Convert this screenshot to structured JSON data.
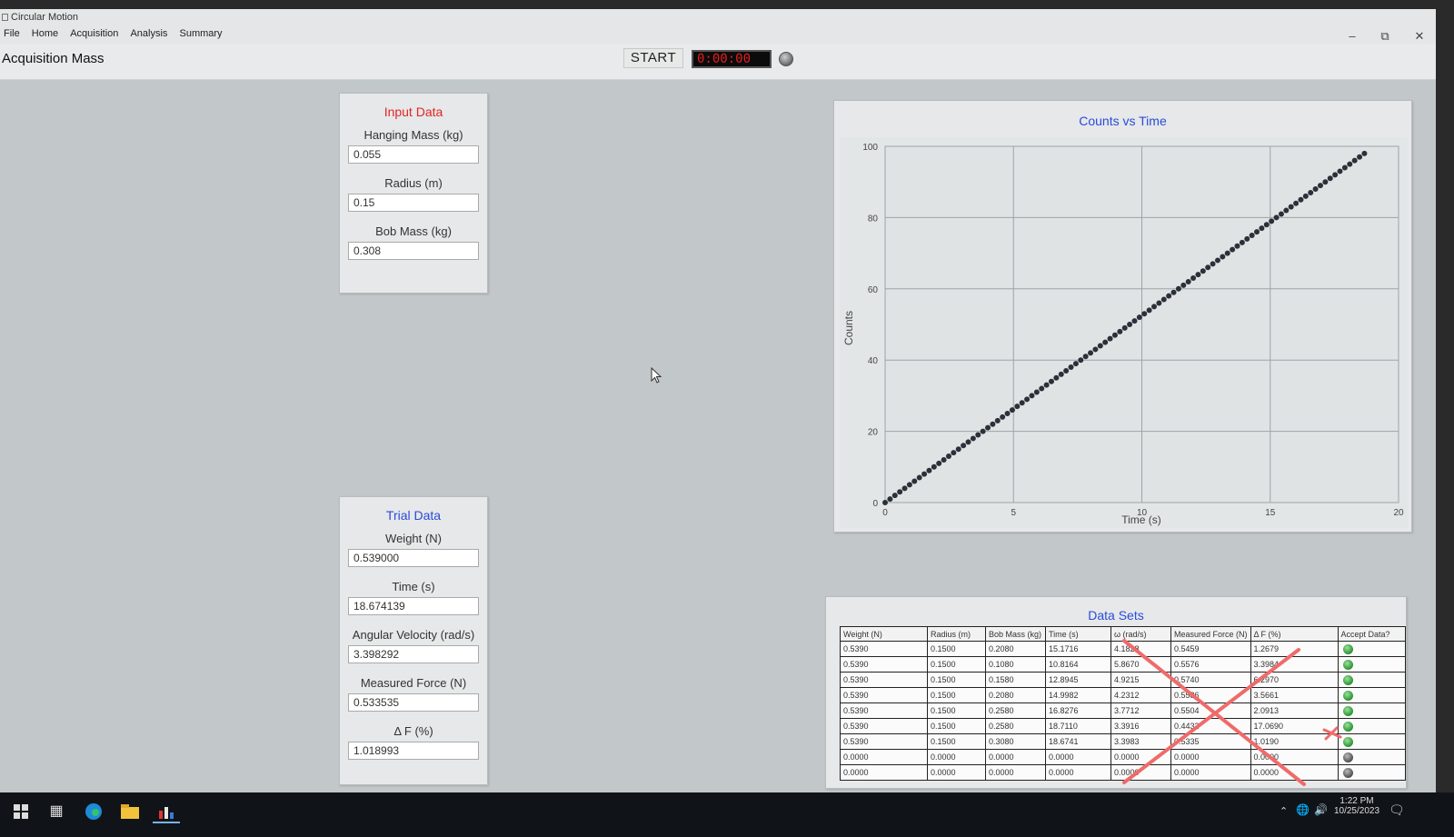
{
  "window": {
    "title": "Circular Motion",
    "menu": [
      "File",
      "Home",
      "Acquisition",
      "Analysis",
      "Summary"
    ]
  },
  "header": {
    "page_title": "Acquisition Mass",
    "start_label": "START",
    "timer": "0:00:00"
  },
  "input_panel": {
    "title": "Input Data",
    "title_color": "#e32424",
    "fields": [
      {
        "label": "Hanging Mass (kg)",
        "value": "0.055"
      },
      {
        "label": "Radius (m)",
        "value": "0.15"
      },
      {
        "label": "Bob Mass (kg)",
        "value": "0.308"
      }
    ]
  },
  "trial_panel": {
    "title": "Trial Data",
    "title_color": "#2b4bd8",
    "fields": [
      {
        "label": "Weight (N)",
        "value": "0.539000"
      },
      {
        "label": "Time (s)",
        "value": "18.674139"
      },
      {
        "label": "Angular Velocity (rad/s)",
        "value": "3.398292"
      },
      {
        "label": "Measured Force (N)",
        "value": "0.533535"
      },
      {
        "label": "Δ F (%)",
        "value": "1.018993"
      }
    ]
  },
  "chart_data": {
    "type": "scatter",
    "title": "Counts vs Time",
    "xlabel": "Time (s)",
    "ylabel": "Counts",
    "xlim": [
      0,
      20
    ],
    "ylim": [
      0,
      100
    ],
    "xticks": [
      0,
      5,
      10,
      15,
      20
    ],
    "yticks": [
      0,
      20,
      40,
      60,
      80,
      100
    ],
    "grid": true,
    "series": [
      {
        "x_start": 0,
        "x_end": 18.67,
        "y_start": 0,
        "y_end": 98,
        "n_points": 99
      }
    ]
  },
  "datasets": {
    "title": "Data Sets",
    "columns": [
      "Weight (N)",
      "Radius (m)",
      "Bob Mass (kg)",
      "Time (s)",
      "ω (rad/s)",
      "Measured Force (N)",
      "Δ F (%)",
      "Accept Data?"
    ],
    "rows": [
      [
        "0.5390",
        "0.1500",
        "0.2080",
        "15.1716",
        "4.1828",
        "0.5459",
        "1.2679",
        "green"
      ],
      [
        "0.5390",
        "0.1500",
        "0.1080",
        "10.8164",
        "5.8670",
        "0.5576",
        "3.3984",
        "green"
      ],
      [
        "0.5390",
        "0.1500",
        "0.1580",
        "12.8945",
        "4.9215",
        "0.5740",
        "6.2970",
        "green"
      ],
      [
        "0.5390",
        "0.1500",
        "0.2080",
        "14.9982",
        "4.2312",
        "0.5586",
        "3.5661",
        "green"
      ],
      [
        "0.5390",
        "0.1500",
        "0.2580",
        "16.8276",
        "3.7712",
        "0.5504",
        "2.0913",
        "green"
      ],
      [
        "0.5390",
        "0.1500",
        "0.2580",
        "18.7110",
        "3.3916",
        "0.4432",
        "17.0690",
        "green"
      ],
      [
        "0.5390",
        "0.1500",
        "0.3080",
        "18.6741",
        "3.3983",
        "0.5335",
        "1.0190",
        "green"
      ],
      [
        "0.0000",
        "0.0000",
        "0.0000",
        "0.0000",
        "0.0000",
        "0.0000",
        "0.0000",
        "gray"
      ],
      [
        "0.0000",
        "0.0000",
        "0.0000",
        "0.0000",
        "0.0000",
        "0.0000",
        "0.0000",
        "gray"
      ]
    ]
  },
  "taskbar": {
    "time": "1:22 PM",
    "date": "10/25/2023"
  }
}
